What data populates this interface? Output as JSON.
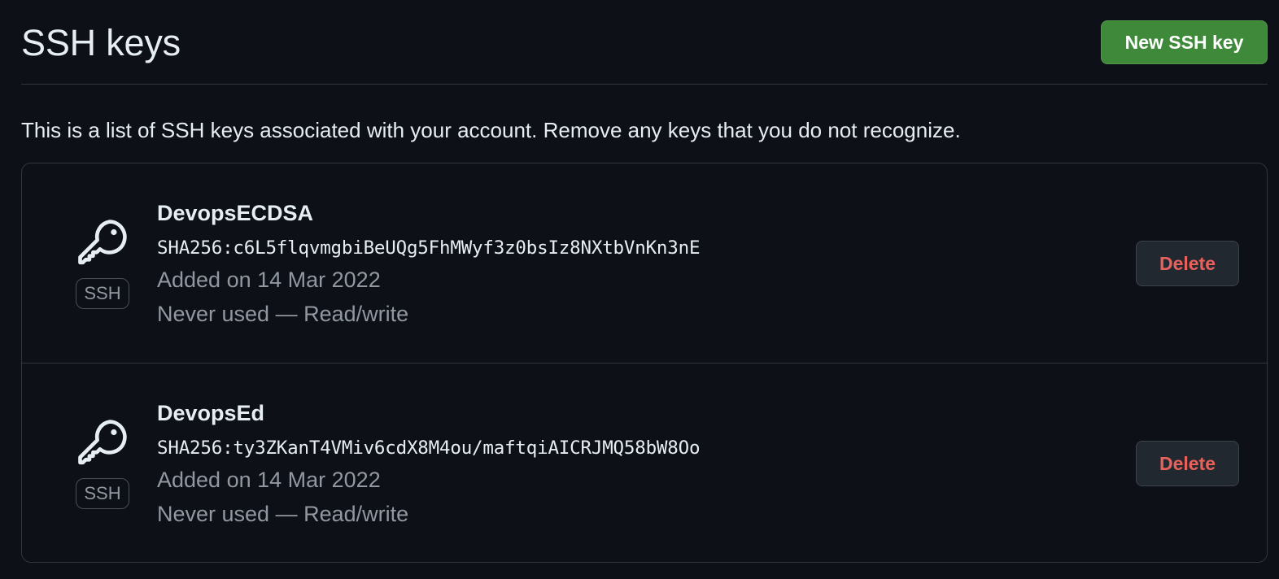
{
  "header": {
    "title": "SSH keys",
    "new_key_label": "New SSH key"
  },
  "intro": "This is a list of SSH keys associated with your account. Remove any keys that you do not recognize.",
  "keys": [
    {
      "name": "DevopsECDSA",
      "fingerprint": "SHA256:c6L5flqvmgbiBeUQg5FhMWyf3z0bsIz8NXtbVnKn3nE",
      "added": "Added on 14 Mar 2022",
      "usage": "Never used — Read/write",
      "badge": "SSH",
      "icon": "key-icon",
      "delete_label": "Delete"
    },
    {
      "name": "DevopsEd",
      "fingerprint": "SHA256:ty3ZKanT4VMiv6cdX8M4ou/maftqiAICRJMQ58bW8Oo",
      "added": "Added on 14 Mar 2022",
      "usage": "Never used — Read/write",
      "badge": "SSH",
      "icon": "key-icon",
      "delete_label": "Delete"
    }
  ],
  "colors": {
    "background": "#0d1117",
    "primary_button": "#3f8a3a",
    "danger_text": "#e8615a",
    "muted_text": "#9198a1",
    "border": "#30363d"
  }
}
